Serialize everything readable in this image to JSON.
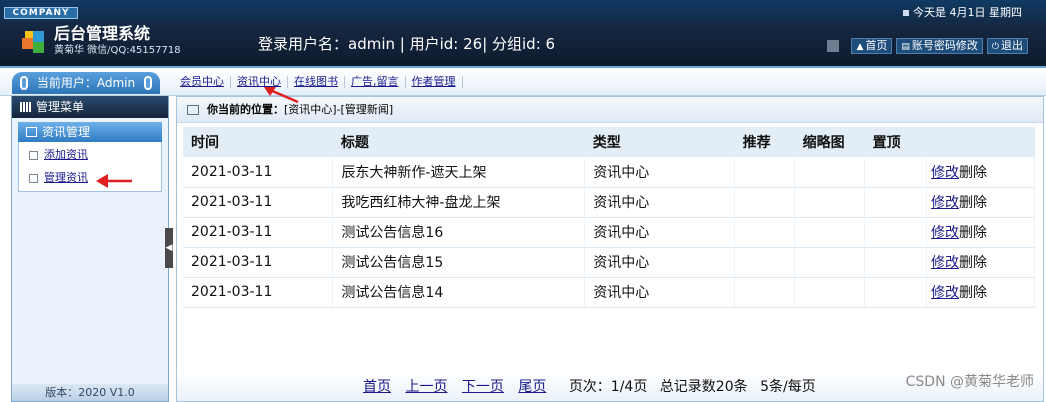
{
  "header": {
    "company": "COMPANY",
    "title": "后台管理系统",
    "subtitle": "黄菊华 微信/QQ:45157718",
    "login_info": "登录用户名：admin | 用户id: 26| 分组id: 6",
    "date": "今天是 4月1日 星期四",
    "buttons": {
      "home": "首页",
      "account": "账号密码修改",
      "logout": "退出"
    }
  },
  "user_tab": "当前用户：Admin",
  "nav": {
    "items": [
      "会员中心",
      "资讯中心",
      "在线图书",
      "广告,留言",
      "作者管理"
    ]
  },
  "sidebar": {
    "menu_title": "管理菜单",
    "section_title": "资讯管理",
    "items": [
      "添加资讯",
      "管理资讯"
    ],
    "version": "版本：2020 V1.0"
  },
  "breadcrumb": {
    "label": "你当前的位置：",
    "path": "[资讯中心]-[管理新闻]"
  },
  "table": {
    "columns": [
      "时间",
      "标题",
      "类型",
      "推荐",
      "缩略图",
      "置顶",
      ""
    ],
    "rows": [
      {
        "date": "2021-03-11",
        "title": "辰东大神新作-遮天上架",
        "type": "资讯中心",
        "recommend": "",
        "thumb": "",
        "top": "",
        "edit": "修改",
        "delete": "删除"
      },
      {
        "date": "2021-03-11",
        "title": "我吃西红柿大神-盘龙上架",
        "type": "资讯中心",
        "recommend": "",
        "thumb": "",
        "top": "",
        "edit": "修改",
        "delete": "删除"
      },
      {
        "date": "2021-03-11",
        "title": "测试公告信息16",
        "type": "资讯中心",
        "recommend": "",
        "thumb": "",
        "top": "",
        "edit": "修改",
        "delete": "删除"
      },
      {
        "date": "2021-03-11",
        "title": "测试公告信息15",
        "type": "资讯中心",
        "recommend": "",
        "thumb": "",
        "top": "",
        "edit": "修改",
        "delete": "删除"
      },
      {
        "date": "2021-03-11",
        "title": "测试公告信息14",
        "type": "资讯中心",
        "recommend": "",
        "thumb": "",
        "top": "",
        "edit": "修改",
        "delete": "删除"
      }
    ]
  },
  "pager": {
    "first": "首页",
    "prev": "上一页",
    "next": "下一页",
    "last": "尾页",
    "page": "页次：1/4页",
    "total": "总记录数20条",
    "per_page": "5条/每页"
  },
  "watermark": "CSDN @黄菊华老师",
  "colors": {
    "header_bg": "#15263f",
    "accent": "#2f7bc3",
    "link": "#1a1a8c",
    "arrow": "#e02020"
  }
}
